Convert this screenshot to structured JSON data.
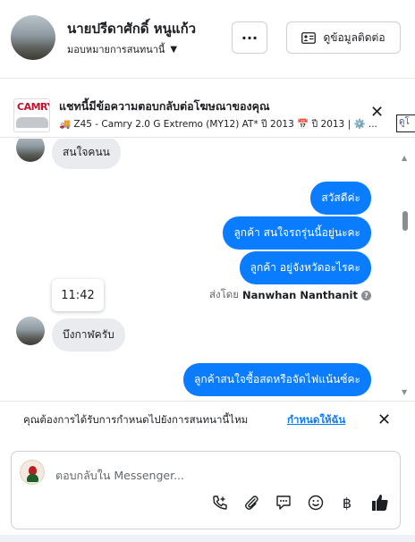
{
  "header": {
    "name": "นายปรีดาศักดิ์ หนูแก้ว",
    "assign_label": "มอบหมายการสนทนานี้",
    "more_label": "···",
    "contact_button": "ดูข้อมูลติดต่อ"
  },
  "ad": {
    "thumb_text": "CAMRY",
    "title": "แชทนี้มีข้อความตอบกลับต่อโฆษณาของคุณ",
    "subtitle": "🚚 Z45 - Camry 2.0 G Extremo (MY12) AT* ปี 2013 📅 ปี 2013 | ⚙️ ...",
    "close_icon": "✕",
    "link_label": "ดูโ"
  },
  "chat": {
    "messages": [
      {
        "side": "in",
        "text": "สนใจคนน"
      },
      {
        "side": "out",
        "text": "สวัสดีค่ะ"
      },
      {
        "side": "out",
        "text": "ลูกค้า  สนใจรถรุ่นนี้อยู่นะคะ"
      },
      {
        "side": "out",
        "text": "ลูกค้า   อยู่จังหวัดอะไรคะ"
      },
      {
        "side": "in",
        "text": "บึงกาฬครับ"
      },
      {
        "side": "out",
        "text": "ลูกค้าสนใจซื้อสดหรือจัดไฟแน้นซ์คะ"
      }
    ],
    "time_tooltip": "11:42",
    "sent_by_label": "ส่งโดย",
    "sent_by_name": "Nanwhan Nanthanit"
  },
  "notice": {
    "text": "คุณต้องการได้รับการกำหนดไปยังการสนทนานี้ไหม",
    "link": "กำหนดให้ฉัน",
    "close_icon": "✕"
  },
  "composer": {
    "placeholder": "ตอบกลับใน Messenger..."
  },
  "colors": {
    "accent": "#0a7cff",
    "incoming_bubble": "#e9ebee"
  }
}
